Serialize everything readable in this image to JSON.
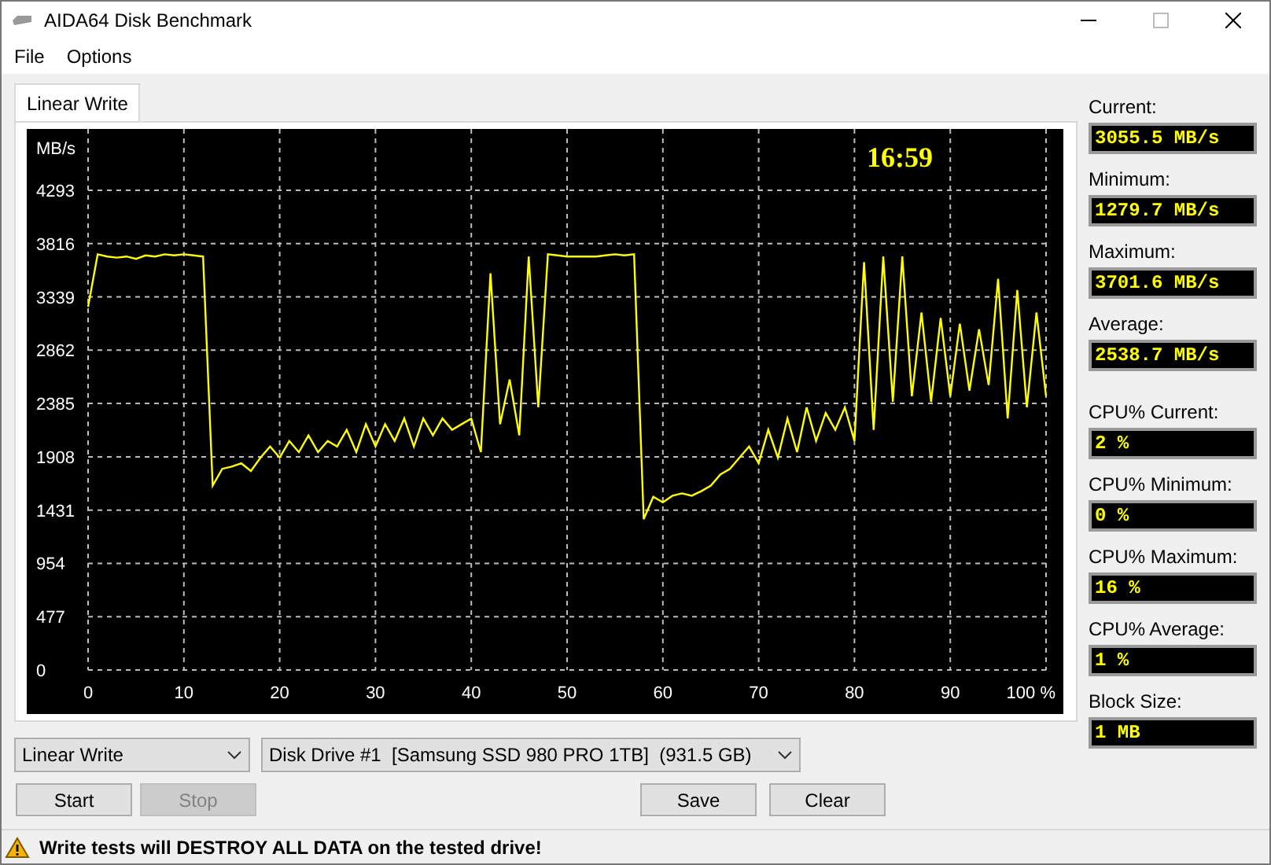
{
  "window": {
    "title": "AIDA64 Disk Benchmark"
  },
  "menu": [
    {
      "label": "File"
    },
    {
      "label": "Options"
    }
  ],
  "tabs": [
    {
      "label": "Linear Write",
      "selected": true
    }
  ],
  "graph": {
    "time": "16:59",
    "chart_data": {
      "type": "line",
      "ylabel": "MB/s",
      "xlim": [
        0,
        100
      ],
      "ylim": [
        0,
        4842
      ],
      "grid": true,
      "xticks": [
        0,
        10,
        20,
        30,
        40,
        50,
        60,
        70,
        80,
        90,
        {
          "value": 100,
          "label": "100 %"
        }
      ],
      "yticks": [
        0,
        477,
        954,
        1431,
        1908,
        2385,
        2862,
        3339,
        3816,
        4293
      ],
      "x": [
        0,
        1,
        2,
        3,
        4,
        5,
        6,
        7,
        8,
        9,
        10,
        11,
        12,
        13,
        14,
        15,
        16,
        17,
        18,
        19,
        20,
        21,
        22,
        23,
        24,
        25,
        26,
        27,
        28,
        29,
        30,
        31,
        32,
        33,
        34,
        35,
        36,
        37,
        38,
        39,
        40,
        41,
        42,
        43,
        44,
        45,
        46,
        47,
        48,
        49,
        50,
        51,
        52,
        53,
        54,
        55,
        56,
        57,
        58,
        59,
        60,
        61,
        62,
        63,
        64,
        65,
        66,
        67,
        68,
        69,
        70,
        71,
        72,
        73,
        74,
        75,
        76,
        77,
        78,
        79,
        80,
        81,
        82,
        83,
        84,
        85,
        86,
        87,
        88,
        89,
        90,
        91,
        92,
        93,
        94,
        95,
        96,
        97,
        98,
        99,
        100
      ],
      "series": [
        {
          "color": "#ffff00",
          "values": [
            3250,
            3720,
            3700,
            3690,
            3700,
            3680,
            3710,
            3700,
            3720,
            3710,
            3720,
            3710,
            3700,
            1650,
            1800,
            1820,
            1850,
            1780,
            1900,
            2000,
            1900,
            2050,
            1950,
            2100,
            1950,
            2050,
            2000,
            2150,
            1950,
            2200,
            2000,
            2200,
            2050,
            2250,
            2000,
            2250,
            2100,
            2250,
            2150,
            2200,
            2250,
            1950,
            3550,
            2200,
            2600,
            2100,
            3700,
            2350,
            3720,
            3710,
            3700,
            3700,
            3700,
            3700,
            3710,
            3720,
            3710,
            3720,
            1350,
            1550,
            1500,
            1560,
            1580,
            1560,
            1600,
            1650,
            1750,
            1800,
            1900,
            2000,
            1850,
            2150,
            1900,
            2250,
            1950,
            2350,
            2050,
            2300,
            2150,
            2350,
            2050,
            3650,
            2150,
            3700,
            2400,
            3700,
            2450,
            3200,
            2400,
            3150,
            2450,
            3100,
            2500,
            3050,
            2550,
            3500,
            2250,
            3400,
            2350,
            3200,
            2450
          ]
        }
      ]
    }
  },
  "stats": [
    {
      "label": "Current:",
      "value": "3055.5 MB/s"
    },
    {
      "label": "Minimum:",
      "value": "1279.7 MB/s"
    },
    {
      "label": "Maximum:",
      "value": "3701.6 MB/s"
    },
    {
      "label": "Average:",
      "value": "2538.7 MB/s"
    },
    {
      "label": "CPU% Current:",
      "value": "2 %"
    },
    {
      "label": "CPU% Minimum:",
      "value": "0 %"
    },
    {
      "label": "CPU% Maximum:",
      "value": "16 %"
    },
    {
      "label": "CPU% Average:",
      "value": "1 %"
    },
    {
      "label": "Block Size:",
      "value": "1 MB"
    }
  ],
  "test_select": {
    "value": "Linear Write"
  },
  "drive_select": {
    "value": "Disk Drive #1  [Samsung SSD 980 PRO 1TB]  (931.5 GB)"
  },
  "buttons": [
    {
      "label": "Start",
      "disabled": false
    },
    {
      "label": "Stop",
      "disabled": true
    },
    {
      "label": "Save",
      "disabled": false
    },
    {
      "label": "Clear",
      "disabled": false
    }
  ],
  "status_bar": {
    "message": "Write tests will DESTROY ALL DATA on the tested drive!"
  }
}
